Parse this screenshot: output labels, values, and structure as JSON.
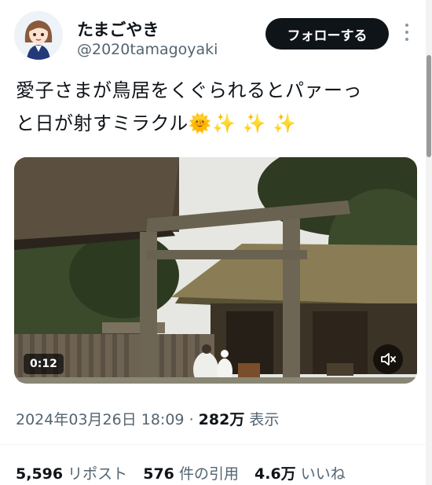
{
  "header": {
    "display_name": "たまごやき",
    "handle": "@2020tamagoyaki",
    "follow_label": "フォローする"
  },
  "tweet": {
    "line1": "愛子さまが鳥居をくぐられるとパァーっ",
    "line2": "と日が射すミラクル",
    "emojis": "🌞✨ ✨ ✨"
  },
  "media": {
    "duration": "0:12",
    "icons": {
      "mute": "speaker-muted-icon"
    }
  },
  "meta": {
    "timestamp": "2024年03月26日 18:09",
    "separator": "·",
    "views": "282万",
    "views_label": "表示"
  },
  "stats": {
    "reposts_count": "5,596",
    "reposts_label": "リポスト",
    "quotes_count": "576",
    "quotes_label": "件の引用",
    "likes_count": "4.6万",
    "likes_label": "いいね"
  },
  "colors": {
    "text_primary": "#0f1419",
    "text_secondary": "#536471",
    "follow_bg": "#0f1419"
  }
}
